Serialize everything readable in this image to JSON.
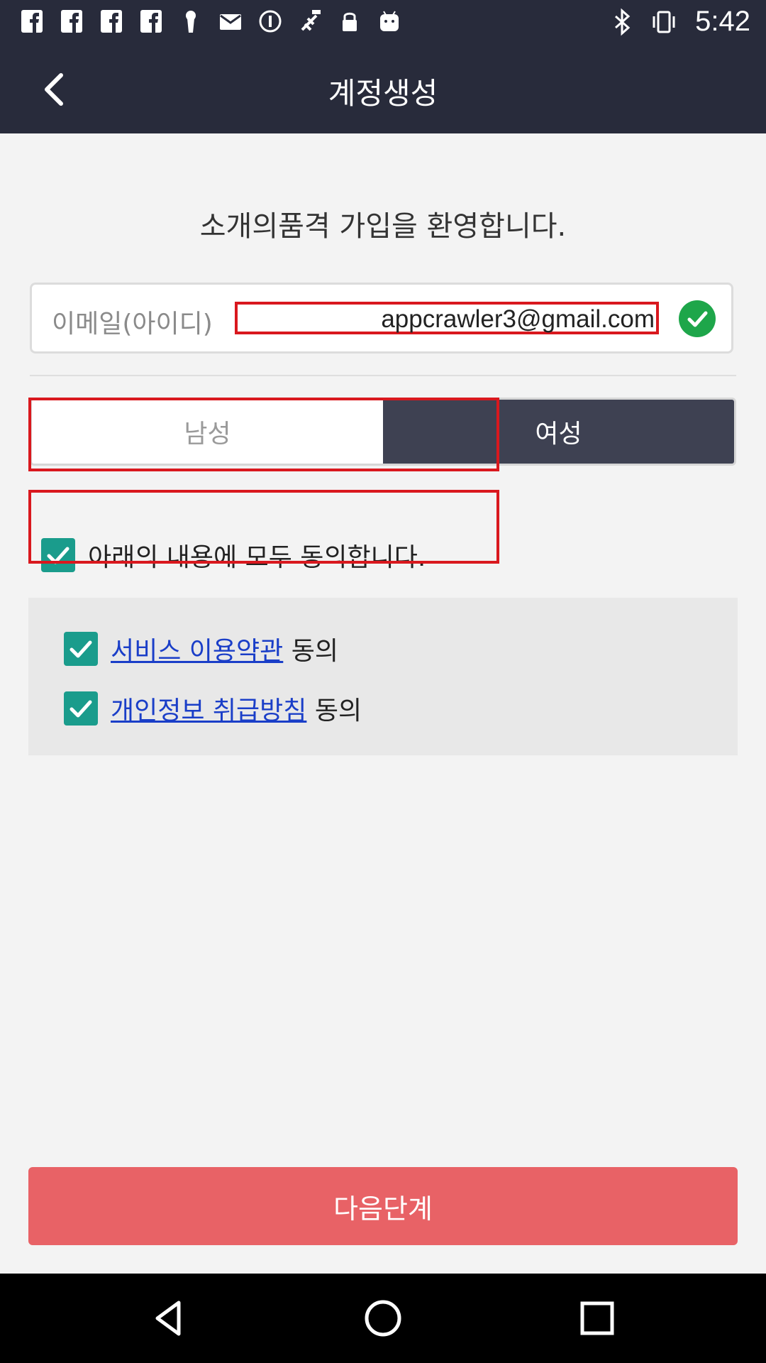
{
  "status_bar": {
    "time": "5:42",
    "left_icons": [
      "facebook-icon",
      "facebook-icon",
      "facebook-icon",
      "facebook-icon",
      "keyhole-icon",
      "mail-icon",
      "info-circle-icon",
      "fake-gps-icon",
      "lock-icon",
      "android-icon"
    ],
    "right_icons": [
      "bluetooth-icon",
      "vibrate-icon"
    ]
  },
  "app_bar": {
    "title": "계정생성"
  },
  "welcome_text": "소개의품격 가입을 환영합니다.",
  "email": {
    "label": "이메일(아이디)",
    "value": "appcrawler3@gmail.com",
    "verified": true
  },
  "gender": {
    "male_label": "남성",
    "female_label": "여성",
    "selected": "여성"
  },
  "agree_all": {
    "label": "아래의 내용에 모두 동의합니다.",
    "checked": true
  },
  "terms": [
    {
      "link": "서비스 이용약관",
      "suffix": " 동의",
      "checked": true
    },
    {
      "link": "개인정보 취급방침",
      "suffix": " 동의",
      "checked": true
    }
  ],
  "next_button": "다음단계",
  "colors": {
    "header": "#282b3b",
    "accent_button": "#e86266",
    "checkbox": "#1a9c8c",
    "verified_green": "#1ea64a",
    "link": "#1a3ec8",
    "highlight_box": "#d9181e"
  }
}
